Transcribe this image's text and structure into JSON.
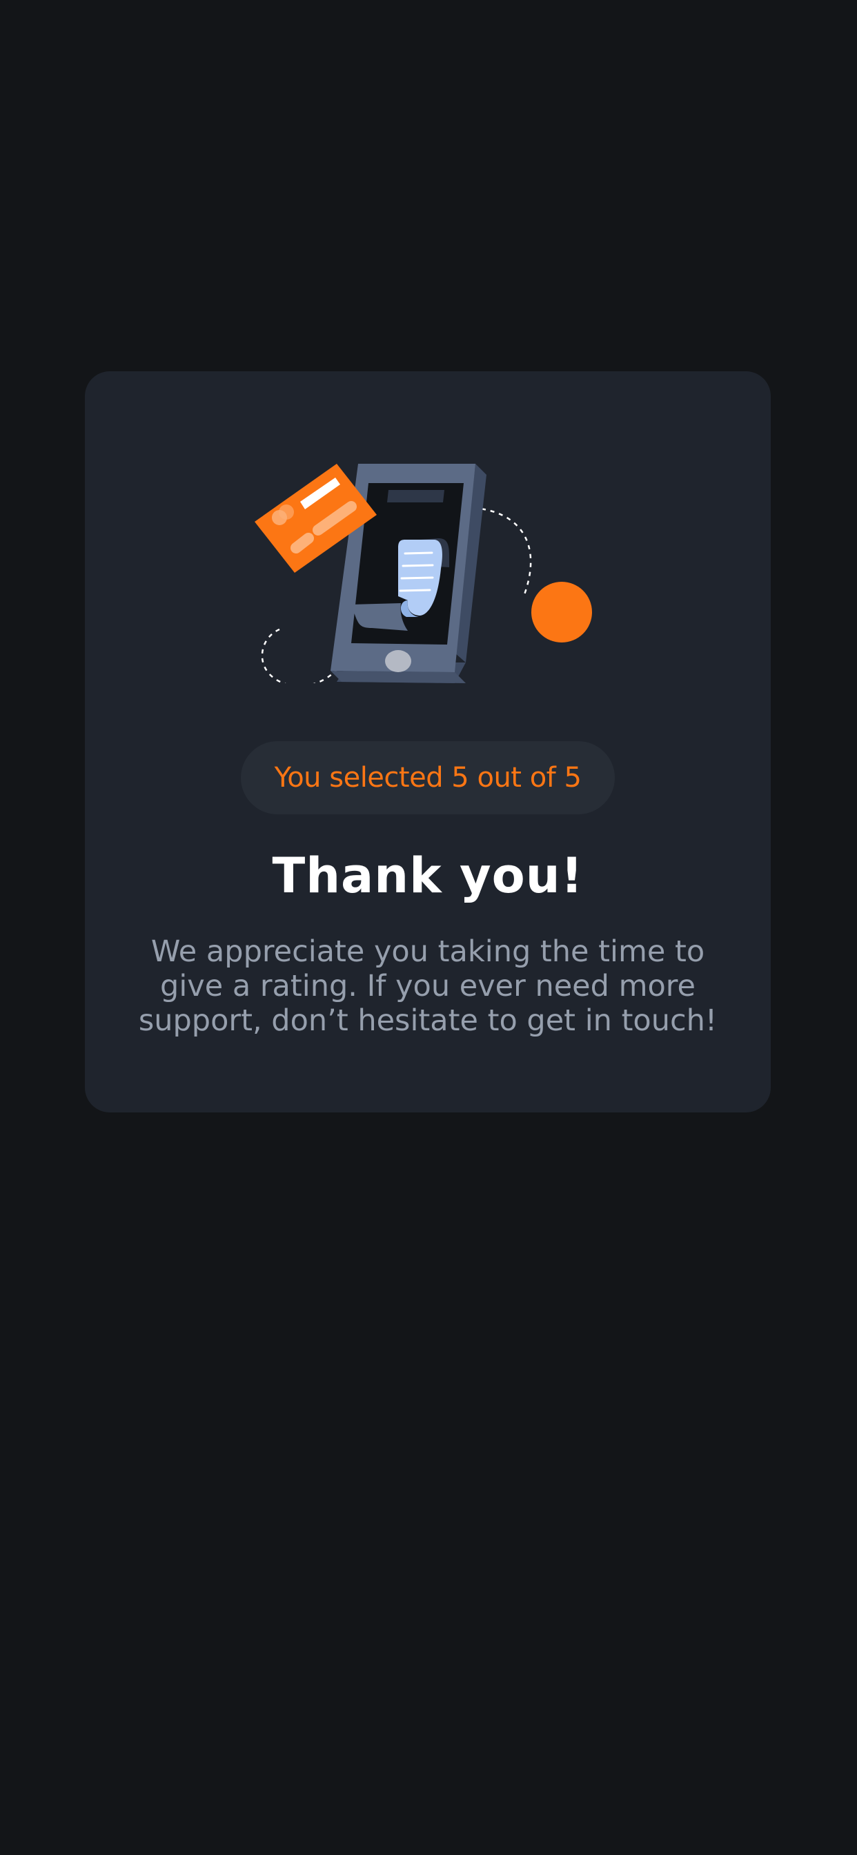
{
  "app": {
    "background_color": "#131518",
    "card_color": "#1f242d",
    "accent_color": "#fc7614"
  },
  "illustration": {
    "icon": "payment-receipt-illustration",
    "elements": [
      "phone-icon",
      "credit-card-icon",
      "receipt-icon",
      "orange-dot-icon"
    ]
  },
  "rating": {
    "selected_text": "You selected 5 out of 5",
    "selected_value": 5,
    "max_value": 5
  },
  "title": "Thank you!",
  "message": "We appreciate you taking the time to give a rating. If you ever need more support, don’t hesitate to get in touch!"
}
